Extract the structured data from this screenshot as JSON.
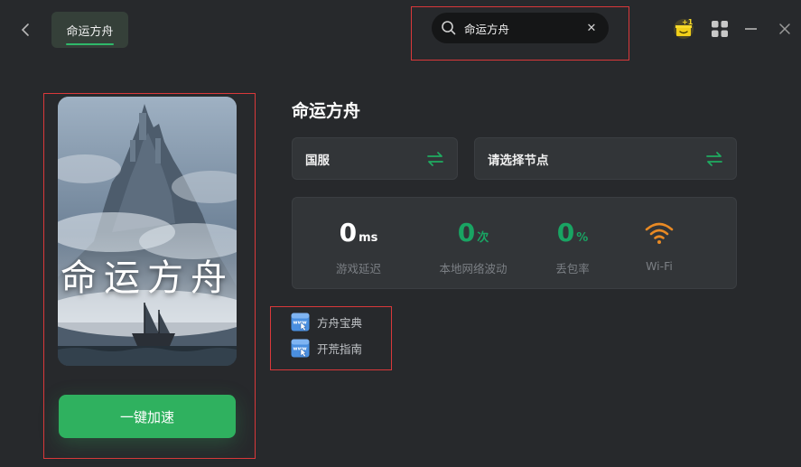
{
  "header": {
    "tab_label": "命运方舟",
    "search": {
      "value": "命运方舟",
      "placeholder": ""
    }
  },
  "game": {
    "title": "命运方舟",
    "cover_title": "命运方舟",
    "accelerate_label": "一键加速"
  },
  "selectors": {
    "region": "国服",
    "node": "请选择节点"
  },
  "stats": {
    "latency": {
      "value": "0",
      "unit": "ms",
      "label": "游戏延迟"
    },
    "jitter": {
      "value": "0",
      "unit": "次",
      "label": "本地网络波动"
    },
    "loss": {
      "value": "0",
      "unit": "%",
      "label": "丢包率"
    },
    "wifi": {
      "label": "Wi-Fi"
    }
  },
  "links": [
    {
      "label": "方舟宝典"
    },
    {
      "label": "开荒指南"
    }
  ],
  "colors": {
    "accent_green": "#2fb15f",
    "stat_green": "#19a463",
    "wifi_orange": "#e98a24",
    "annotation_red": "#d9383a"
  },
  "icons": [
    "back-icon",
    "search-icon",
    "clear-icon",
    "gift-icon",
    "apps-icon",
    "minimize-icon",
    "close-icon",
    "swap-icon",
    "wifi-icon",
    "www-link-icon"
  ]
}
